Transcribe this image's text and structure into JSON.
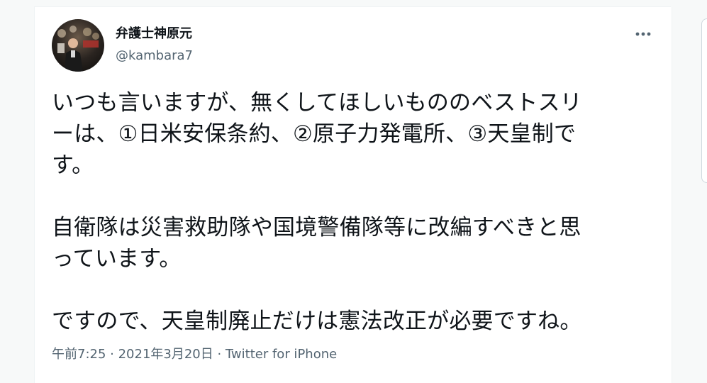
{
  "author": {
    "display_name": "弁護士神原元",
    "handle": "@kambara7"
  },
  "menu": {
    "icon": "more-horizontal-icon"
  },
  "tweet": {
    "line1": "いつも言いますが、無くしてほしいもののベストスリ",
    "line2": "ーは、①日米安保条約、②原子力発電所、③天皇制で",
    "line3": "す。",
    "line4": "自衛隊は災害救助隊や国境警備隊等に改編すべきと思",
    "line5": "っています。",
    "line6": "ですので、天皇制廃止だけは憲法改正が必要ですね。"
  },
  "meta": {
    "timestamp": "午前7:25 · 2021年3月20日 · Twitter for iPhone"
  },
  "colors": {
    "text": "#0f1419",
    "secondary": "#536471",
    "border": "#eff3f4"
  }
}
